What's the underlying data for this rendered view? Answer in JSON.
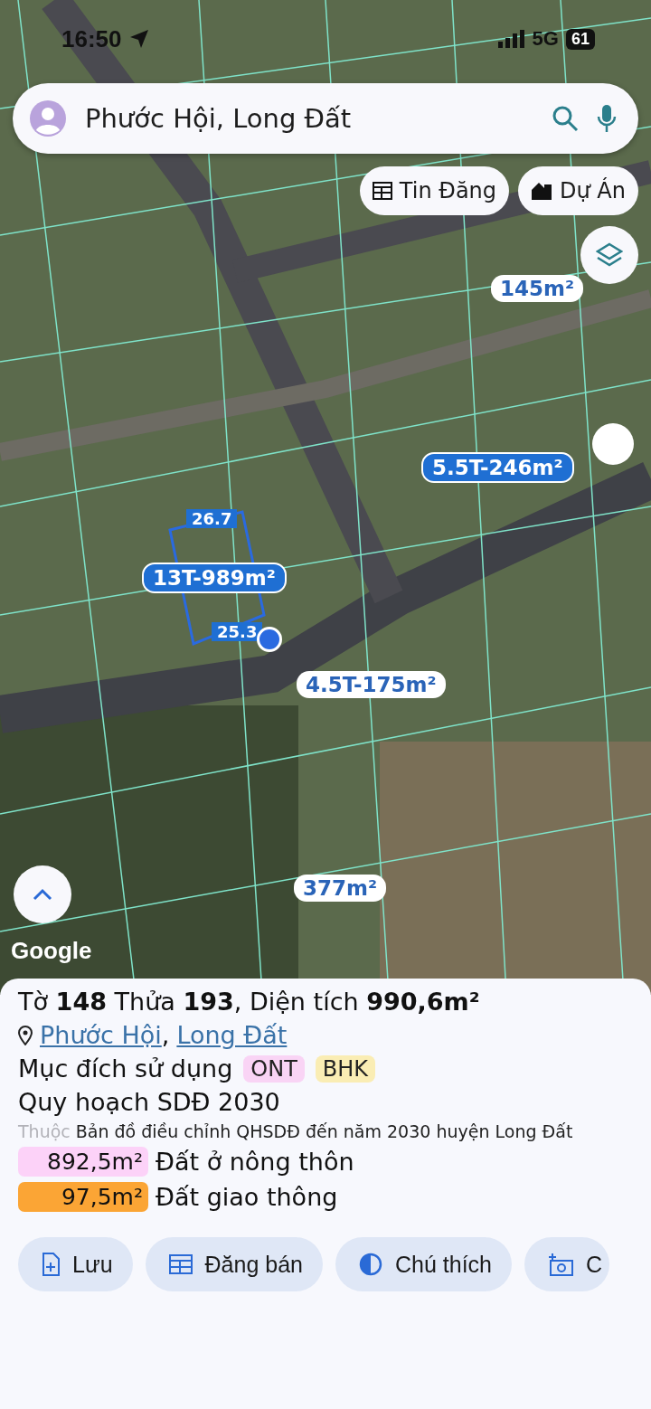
{
  "status_bar": {
    "time": "16:50",
    "network": "5G",
    "battery": "61"
  },
  "search": {
    "value": "Phước Hội, Long Đất"
  },
  "chips": [
    {
      "label": "Tin Đăng",
      "kind": "listing"
    },
    {
      "label": "Dự Án",
      "kind": "project"
    }
  ],
  "map": {
    "logo": "Google",
    "area_labels": [
      {
        "text": "145m²",
        "kind": "outline"
      },
      {
        "text": "5.5T-246m²",
        "kind": "filled"
      },
      {
        "text": "13T-989m²",
        "kind": "filled"
      },
      {
        "text": "4.5T-175m²",
        "kind": "outline"
      },
      {
        "text": "377m²",
        "kind": "outline"
      }
    ],
    "edge_labels": [
      "26.7",
      "25.3"
    ]
  },
  "parcel": {
    "title": "Tờ **148** Thửa **193**, Diện tích **990,6m²**",
    "locations": [
      "Phước Hội",
      "Long Đất"
    ],
    "location_separator": ",",
    "purpose_label": "Mục đích sử dụng",
    "purpose_tags": [
      {
        "code": "ONT",
        "color": "#f9d4f5"
      },
      {
        "code": "BHK",
        "color": "#faedb4"
      }
    ],
    "plan_title": "Quy hoạch SDĐ 2030",
    "source_prefix": "Thuộc",
    "source": "Bản đồ điều chỉnh QHSDĐ đến năm 2030 huyện Long Đất",
    "land_uses": [
      {
        "area": "892,5m²",
        "name": "Đất ở nông thôn",
        "color": "#fcd2f8"
      },
      {
        "area": "97,5m²",
        "name": "Đất giao thông",
        "color": "#fba535"
      }
    ]
  },
  "actions": [
    {
      "label": "Lưu",
      "kind": "save"
    },
    {
      "label": "Đăng bán",
      "kind": "sell"
    },
    {
      "label": "Chú thích",
      "kind": "legend"
    },
    {
      "label": "C",
      "kind": "photo"
    }
  ]
}
